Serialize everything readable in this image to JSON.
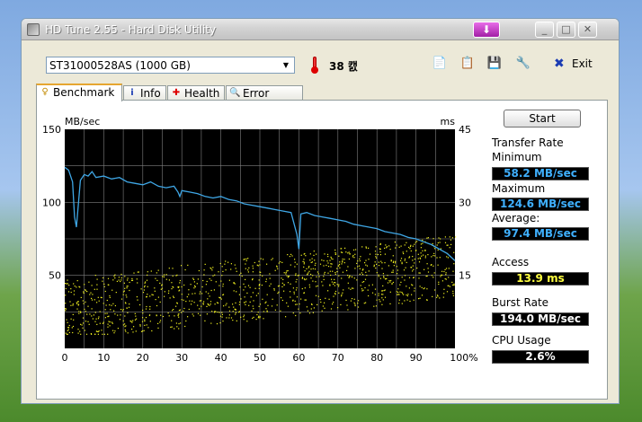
{
  "window": {
    "title": "HD Tune 2.55 - Hard Disk Utility"
  },
  "toolbar": {
    "drive": "ST31000528AS (1000 GB)",
    "temperature": "38 캜",
    "exit_label": "Exit"
  },
  "tabs": [
    {
      "label": "Benchmark"
    },
    {
      "label": "Info"
    },
    {
      "label": "Health"
    },
    {
      "label": "Error Scan"
    }
  ],
  "side": {
    "start_label": "Start",
    "transfer_rate_label": "Transfer Rate",
    "minimum_label": "Minimum",
    "minimum_value": "58.2 MB/sec",
    "maximum_label": "Maximum",
    "maximum_value": "124.6 MB/sec",
    "average_label": "Average:",
    "average_value": "97.4 MB/sec",
    "access_label": "Access",
    "access_value": "13.9 ms",
    "burst_label": "Burst Rate",
    "burst_value": "194.0 MB/sec",
    "cpu_label": "CPU Usage",
    "cpu_value": "2.6%"
  },
  "colors": {
    "plot_bg": "#000000",
    "grid": "#808080",
    "transfer_line": "#3fa7e6",
    "access_points": "#f0f020",
    "transfer_box_text": "#3fb0ff",
    "access_box_text": "#ffff40",
    "white_box_text": "#ffffff"
  },
  "chart_data": {
    "type": "line",
    "xlabel": "",
    "y_left_label": "MB/sec",
    "y_right_label": "ms",
    "xlim": [
      0,
      100
    ],
    "ylim_left": [
      0,
      150
    ],
    "ylim_right": [
      0,
      45
    ],
    "x_ticks": [
      "0",
      "10",
      "20",
      "30",
      "40",
      "50",
      "60",
      "70",
      "80",
      "90",
      "100%"
    ],
    "y_left_ticks": [
      "150",
      "100",
      "50"
    ],
    "y_right_ticks": [
      "45",
      "30",
      "15"
    ],
    "grid": true,
    "series": [
      {
        "axis": "left",
        "x": [
          0,
          1,
          2,
          2.5,
          3,
          4,
          5,
          6,
          7,
          8,
          10,
          12,
          14,
          16,
          18,
          20,
          22,
          24,
          26,
          28,
          29,
          29.5,
          30,
          32,
          34,
          36,
          38,
          40,
          42,
          44,
          46,
          48,
          50,
          52,
          54,
          56,
          58,
          59.5,
          60,
          60.5,
          62,
          64,
          66,
          68,
          70,
          72,
          74,
          76,
          78,
          80,
          82,
          84,
          86,
          88,
          90,
          92,
          94,
          96,
          98,
          100
        ],
        "values": [
          124,
          122,
          114,
          90,
          83,
          115,
          119,
          118,
          121,
          117,
          118,
          116,
          117,
          114,
          113,
          112,
          114,
          111,
          110,
          111,
          107,
          104,
          108,
          107,
          106,
          104,
          103,
          104,
          102,
          101,
          99,
          98,
          97,
          96,
          95,
          94,
          93,
          78,
          68,
          92,
          93,
          91,
          90,
          89,
          88,
          87,
          85,
          84,
          83,
          82,
          80,
          79,
          78,
          76,
          75,
          73,
          71,
          68,
          65,
          60
        ]
      }
    ],
    "access_scatter": {
      "axis": "right",
      "y_min_ms": 3,
      "y_max_ms": 23,
      "trend": "rising",
      "point_count": 1200
    }
  }
}
